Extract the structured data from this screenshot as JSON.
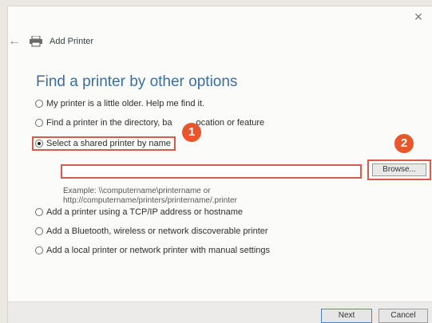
{
  "window": {
    "close_icon": "close-icon",
    "back_icon": "back-arrow-icon",
    "printer_icon": "printer-icon",
    "title": "Add Printer"
  },
  "main": {
    "heading": "Find a printer by other options",
    "options": [
      {
        "label": "My printer is a little older. Help me find it.",
        "checked": false
      },
      {
        "label": "Find a printer in the directory, ba",
        "label_tail": "ocation or feature",
        "checked": false
      },
      {
        "label": "Select a shared printer by name",
        "checked": true
      },
      {
        "label": "Add a printer using a TCP/IP address or hostname",
        "checked": false
      },
      {
        "label": "Add a Bluetooth, wireless or network discoverable printer",
        "checked": false
      },
      {
        "label": "Add a local printer or network printer with manual settings",
        "checked": false
      }
    ],
    "printer_name_value": "",
    "browse_label": "Browse...",
    "example_line1": "Example: \\\\computername\\printername or",
    "example_line2": "http://computername/printers/printername/.printer"
  },
  "badges": {
    "one": "1",
    "two": "2",
    "color": "#e8562c"
  },
  "footer": {
    "next_label": "Next",
    "cancel_label": "Cancel"
  },
  "colors": {
    "heading": "#3c6ea0",
    "highlight": "#d85a4a"
  }
}
